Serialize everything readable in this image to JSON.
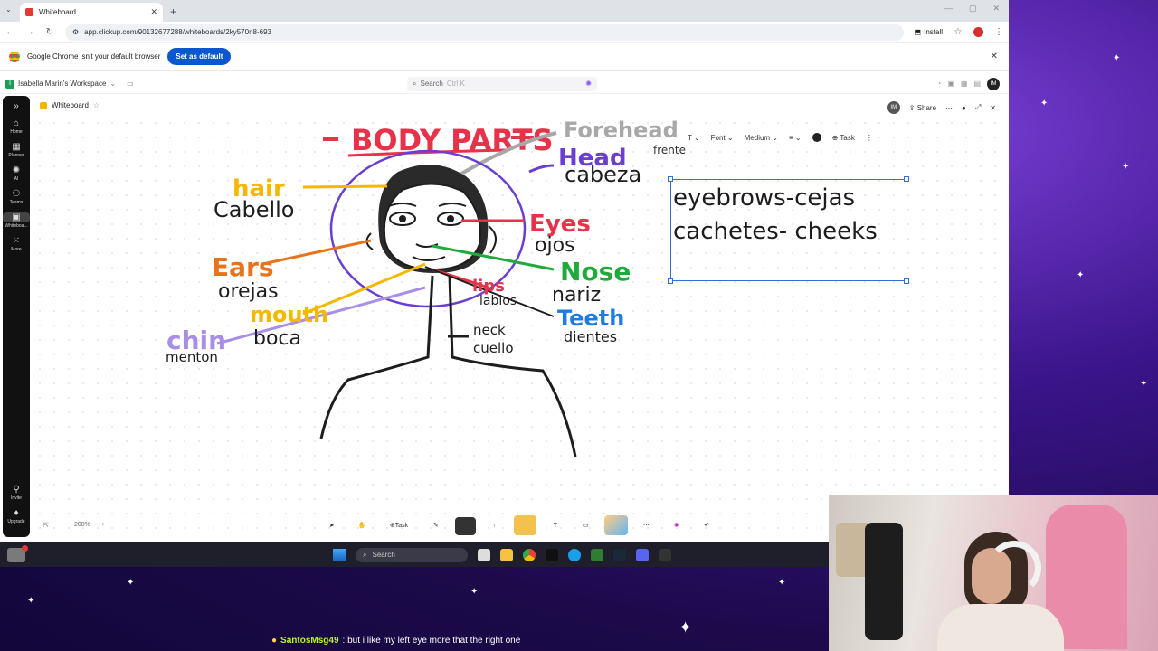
{
  "browser": {
    "tab_title": "Whiteboard",
    "url": "app.clickup.com/90132677288/whiteboards/2ky570n8-693",
    "install_label": "Install",
    "infobar_text": "Google Chrome isn't your default browser",
    "set_default_label": "Set as default"
  },
  "app": {
    "workspace": "Isabella Marin's Workspace",
    "search_placeholder": "Search",
    "search_shortcut": "Ctrl K",
    "avatar_initials": "IM",
    "rail": {
      "home": "Home",
      "planner": "Planner",
      "ai": "AI",
      "teams": "Teams",
      "whiteboard": "Whiteboa...",
      "more": "More",
      "invite": "Invite",
      "upgrade": "Upgrade"
    },
    "page_title": "Whiteboard",
    "share_label": "Share"
  },
  "format_toolbar": {
    "font_label": "Font",
    "size_label": "Medium",
    "task_label": "Task"
  },
  "whiteboard": {
    "title": "- BODY PARTS -",
    "labels": {
      "forehead": "Forehead",
      "frente": "frente",
      "head": "Head",
      "cabeza": "cabeza",
      "hair": "hair",
      "cabello": "Cabello",
      "eyes": "Eyes",
      "ojos": "ojos",
      "ears": "Ears",
      "orejas": "orejas",
      "nose": "Nose",
      "nariz": "nariz",
      "lips": "lips",
      "labios": "labios",
      "mouth": "mouth",
      "boca": "boca",
      "teeth": "Teeth",
      "dientes": "dientes",
      "chin": "chin",
      "menton": "menton",
      "neck": "neck",
      "cuello": "cuello"
    },
    "textbox_lines": [
      "eyebrows-cejas",
      "cachetes- cheeks"
    ],
    "zoom_level": "200%"
  },
  "toolbar": {
    "task_label": "Task"
  },
  "taskbar": {
    "search_placeholder": "Search"
  },
  "chat": {
    "username": "SantosMsg49",
    "message": ": but i like my left eye more that the right one"
  },
  "colors": {
    "title_red": "#e8324a",
    "face_purple": "#6a3fd0",
    "hair_yellow": "#f5b800",
    "ears_orange": "#e8731c",
    "nose_green": "#1faa3b",
    "teeth_blue": "#1e7be0",
    "chin_lavender": "#a98ee6",
    "forehead_gray": "#a8a8a8"
  }
}
